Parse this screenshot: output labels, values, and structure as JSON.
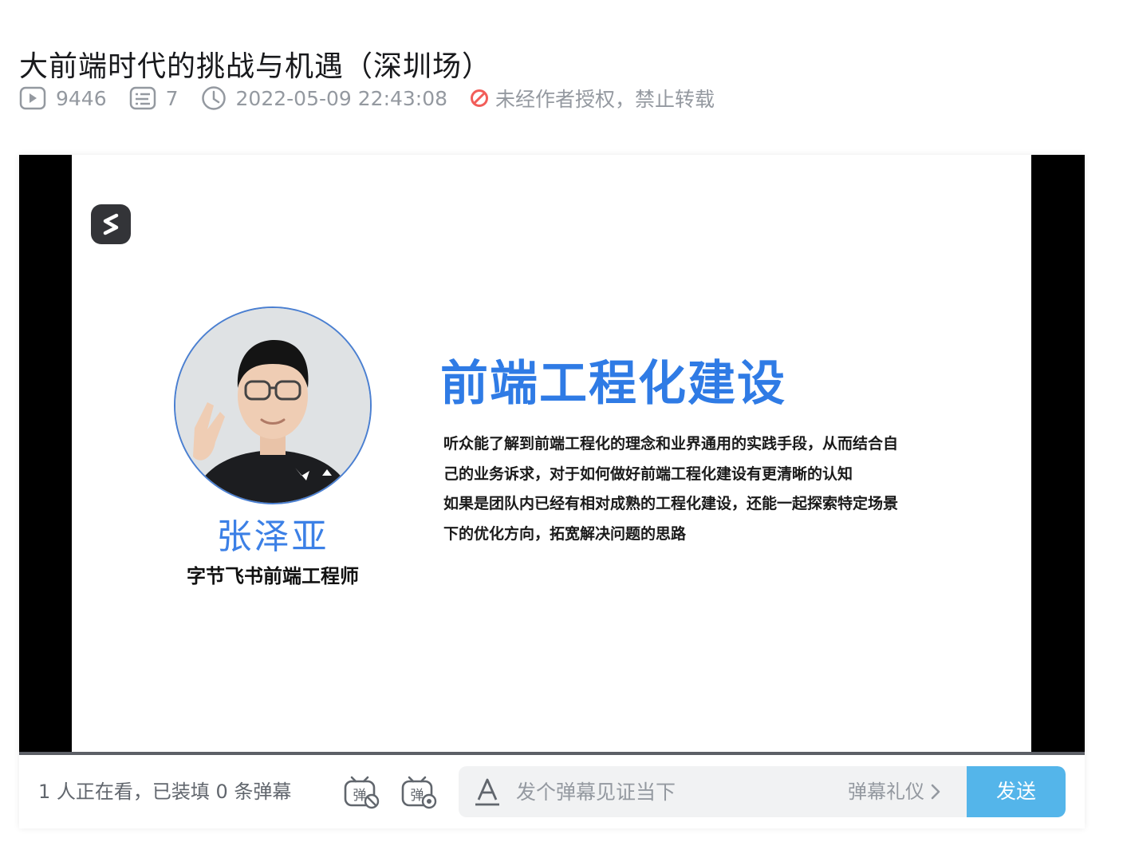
{
  "video": {
    "title": "大前端时代的挑战与机遇（深圳场）",
    "stats": {
      "plays": "9446",
      "danmaku_count": "7",
      "publish_time": "2022-05-09 22:43:08",
      "copyright_notice": "未经作者授权，禁止转载"
    }
  },
  "slide": {
    "speaker_name": "张泽亚",
    "speaker_role": "字节飞书前端工程师",
    "heading": "前端工程化建设",
    "body_lines": [
      "听众能了解到前端工程化的理念和业界通用的实践手段，从而结合自",
      "己的业务诉求，对于如何做好前端工程化建设有更清晰的认知",
      "如果是团队内已经有相对成熟的工程化建设，还能一起探索特定场景",
      "下的优化方向，拓宽解决问题的思路"
    ]
  },
  "danmaku_bar": {
    "viewer_status": "1 人正在看，已装填 0 条弹幕",
    "input_placeholder": "发个弹幕见证当下",
    "etiquette_label": "弹幕礼仪",
    "send_label": "发送",
    "icon_glyph": "弹"
  },
  "icons": {
    "plays": "play-count-icon",
    "danmaku": "danmaku-count-icon",
    "time": "clock-icon",
    "copyright": "no-repost-icon",
    "danmaku_toggle": "danmaku-toggle-icon",
    "danmaku_settings": "danmaku-settings-icon",
    "font": "font-style-icon",
    "chevron": "chevron-right-icon"
  },
  "colors": {
    "accent_blue": "#2f7be5",
    "send_button": "#54b5ea",
    "warning_red": "#f25d59",
    "meta_gray": "#9499a0"
  }
}
